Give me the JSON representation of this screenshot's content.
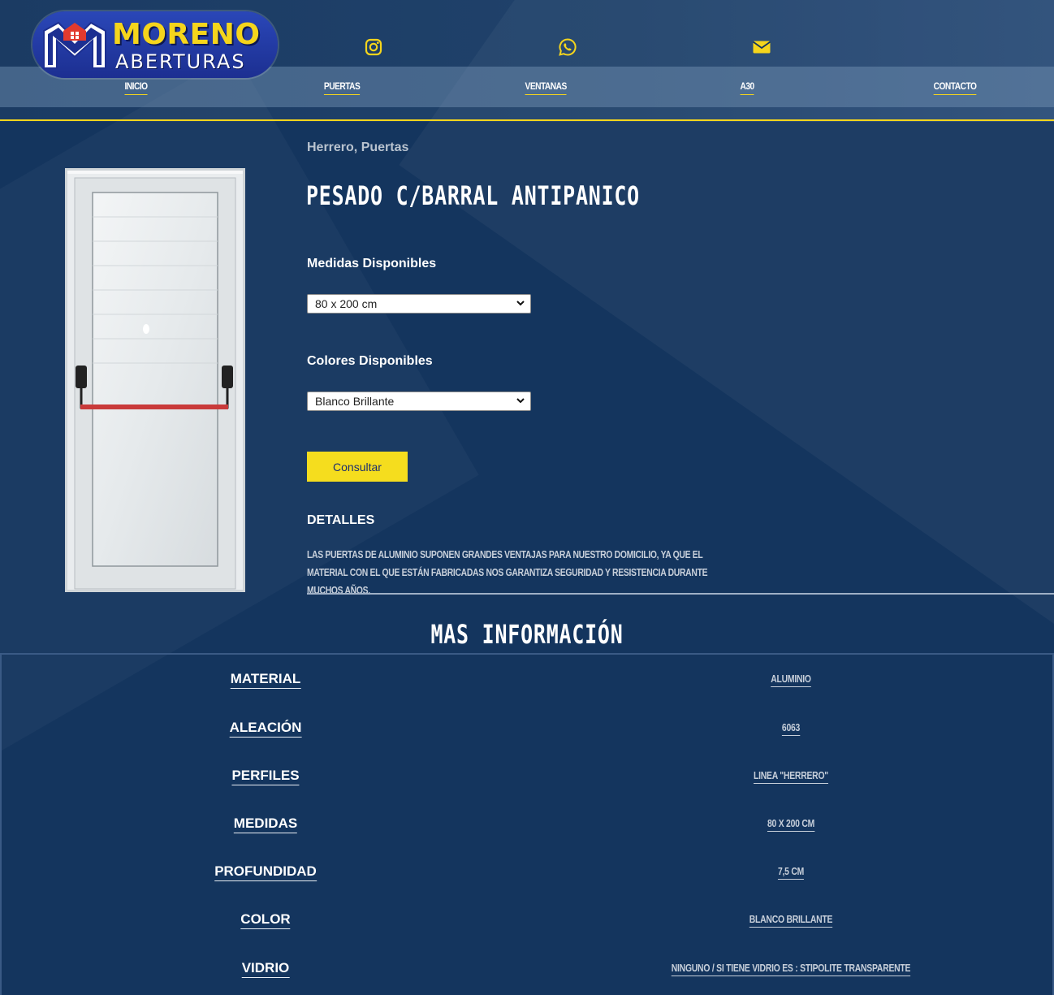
{
  "brand": {
    "name_line1": "MORENO",
    "name_line2": "ABERTURAS",
    "primary_color": "#14355e",
    "accent_color": "#f5d51c"
  },
  "social": [
    {
      "icon": "instagram-icon"
    },
    {
      "icon": "whatsapp-icon"
    },
    {
      "icon": "envelope-icon"
    }
  ],
  "nav": {
    "items": [
      {
        "label": "INICIO"
      },
      {
        "label": "PUERTAS"
      },
      {
        "label": "VENTANAS"
      },
      {
        "label": "A30"
      },
      {
        "label": "CONTACTO"
      }
    ]
  },
  "product": {
    "categories": "Herrero, Puertas",
    "title": "PESADO C/BARRAL ANTIPANICO",
    "sizes_label": "Medidas Disponibles",
    "sizes_selected": "80 x 200 cm",
    "colors_label": "Colores Disponibles",
    "colors_selected": "Blanco Brillante",
    "consult_button": "Consultar",
    "details_title": "DETALLES",
    "details_text": "Las puertas de aluminio suponen grandes ventajas para nuestro domicilio, ya que el material con el que están fabricadas nos garantiza seguridad y resistencia durante muchos años."
  },
  "more_info": {
    "title": "MAS INFORMACIÓN",
    "rows": [
      {
        "key": "MATERIAL",
        "value": "ALUMINIO"
      },
      {
        "key": "ALEACIÓN",
        "value": "6063"
      },
      {
        "key": "PERFILES",
        "value": "LINEA \"HERRERO\""
      },
      {
        "key": "MEDIDAS",
        "value": "80 X 200 CM"
      },
      {
        "key": "PROFUNDIDAD",
        "value": "7,5 CM"
      },
      {
        "key": "COLOR",
        "value": "BLANCO BRILLANTE"
      },
      {
        "key": "VIDRIO",
        "value": "NINGUNO / SI TIENE VIDRIO ES : STIPOLITE TRANSPARENTE"
      }
    ]
  }
}
